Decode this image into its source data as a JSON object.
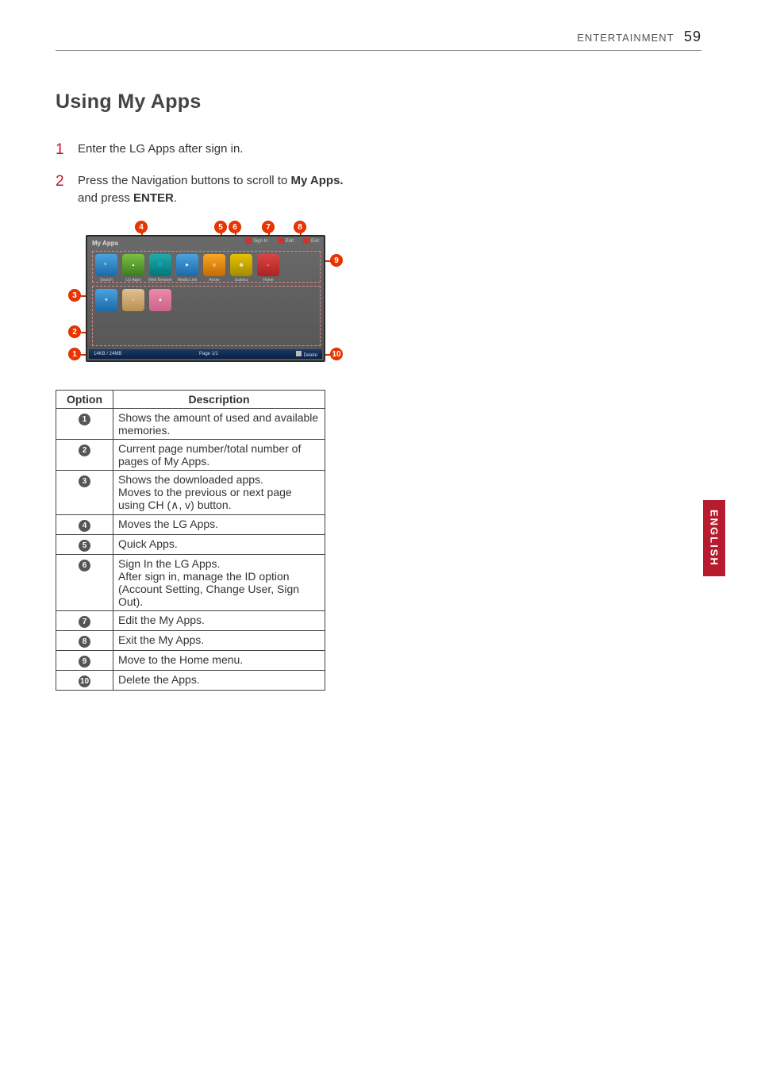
{
  "header": {
    "section": "ENTERTAINMENT",
    "page_number": "59"
  },
  "title": "Using My Apps",
  "steps": {
    "s1": "Enter the LG Apps after sign in.",
    "s2_a": "Press the Navigation buttons to scroll to ",
    "s2_b": "My Apps.",
    "s2_c": " and press ",
    "s2_d": "ENTER",
    "s2_e": "."
  },
  "screenshot": {
    "title": "My Apps",
    "top_items": {
      "signin": "Sign In",
      "edit": "Edit",
      "exit": "Exit"
    },
    "quick_apps": [
      {
        "label": "Search"
      },
      {
        "label": "LG Apps"
      },
      {
        "label": "Web Browser"
      },
      {
        "label": "Media Link"
      },
      {
        "label": "Arrow"
      },
      {
        "label": "Sudoku"
      },
      {
        "label": "Home"
      }
    ],
    "status": {
      "mem": "14KB / 24MB",
      "page": "Page 1/1",
      "delete": "Delete"
    }
  },
  "callouts": {
    "n1": "1",
    "n2": "2",
    "n3": "3",
    "n4": "4",
    "n5": "5",
    "n6": "6",
    "n7": "7",
    "n8": "8",
    "n9": "9",
    "n10": "10"
  },
  "table": {
    "head_option": "Option",
    "head_desc": "Description",
    "rows": [
      {
        "n": "1",
        "desc": "Shows the amount of used and available memories."
      },
      {
        "n": "2",
        "desc": "Current page number/total number of pages of My Apps."
      },
      {
        "n": "3",
        "desc": "Shows the downloaded apps.\nMoves to the previous or next page using CH (∧, v) button."
      },
      {
        "n": "4",
        "desc": "Moves the LG Apps."
      },
      {
        "n": "5",
        "desc": "Quick Apps."
      },
      {
        "n": "6",
        "desc": "Sign In the LG Apps.\nAfter sign in, manage the ID option (Account Setting, Change User, Sign Out)."
      },
      {
        "n": "7",
        "desc": "Edit the My Apps."
      },
      {
        "n": "8",
        "desc": "Exit the My Apps."
      },
      {
        "n": "9",
        "desc": "Move to the Home menu."
      },
      {
        "n": "10",
        "desc": "Delete the Apps."
      }
    ]
  },
  "language_tab": "ENGLISH"
}
